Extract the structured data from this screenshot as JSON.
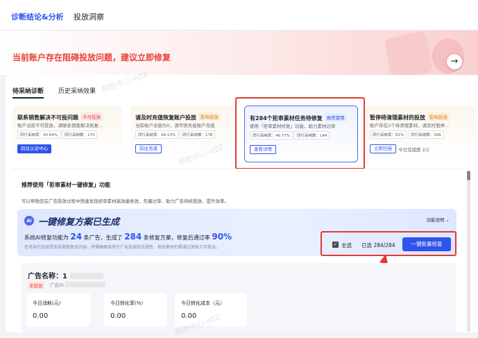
{
  "top_tabs": [
    "诊断结论&分析",
    "投放洞察"
  ],
  "banner": {
    "text": "当前账户存在阻碍投放问题，建议立即修复"
  },
  "sub_tabs": [
    "待采纳诊断",
    "历史采纳效果"
  ],
  "cards": [
    {
      "title": "联系销售解决不可投问题",
      "badge": "不可投放",
      "desc": "账户当前不可投放，请联系销售解决恢复...",
      "metrics": [
        "同行采纳率：40.64%",
        "同行采纳数：170"
      ],
      "button": "前往认证中心"
    },
    {
      "title": "请及时充值恢复账户投放",
      "badge": "影响投放",
      "desc": "当前账户余额为0，请尽快充值账户充值",
      "metrics": [
        "同行采纳率：49.13%",
        "同行采纳数：178"
      ],
      "button": "前往充值"
    },
    {
      "title": "有284个拒审素材任务待修复",
      "badge": "推荐使用",
      "desc": "使用「拒审素材修复」功能，助力素材过审",
      "metrics": [
        "同行采纳率：46.77%",
        "同行采纳数：144"
      ],
      "button": "查看详情"
    },
    {
      "title": "暂停待清理素材的投放",
      "badge": "影响投放",
      "desc": "账户存在2个待清理素材，请及时暂停...",
      "metrics": [
        "同行采纳率：81%",
        "同行采纳数：266"
      ],
      "button": "立即扫描",
      "progress": "今日完成度 2/2"
    }
  ],
  "detail": {
    "title": "推荐使用「拒审素材一键修复」功能",
    "subtitle": "可以帮助您在广告投放过程中快速发现拒审素材高效量修改、先摄过审、助力广告持续投放、提升效率。",
    "plan": {
      "ai": "AI",
      "title": "一键修复方案已生成",
      "info_prefix": "系统AI修复功能为",
      "ads": "24",
      "info_mid1": "条广告，生成了",
      "plans": "284",
      "info_mid2": "条修复方案，修复后通过率",
      "rate": "90%",
      "note": "您可自行选择是否采用修复后内容，并需确保其用于广告投放的合规性，相关素材仍需通过审核方可投出。",
      "func_label": "功能说明"
    },
    "select_all": "全选",
    "selected": "已选 284/284",
    "batch_button": "一键批量修复"
  },
  "ad": {
    "name_label": "广告名称：",
    "name_value": "1",
    "status": "未投放",
    "id_label": "广告ID",
    "stats": [
      {
        "label": "今日消耗(元)",
        "value": "0.00"
      },
      {
        "label": "今日转化率(%)",
        "value": "0.00"
      },
      {
        "label": "今日转化成本（元）",
        "value": "0.00"
      }
    ]
  },
  "watermark": "帮助中心-e02",
  "colors": {
    "accent": "#2f54eb",
    "warning_red": "#e8413a",
    "annotation_red": "#e33a32"
  }
}
